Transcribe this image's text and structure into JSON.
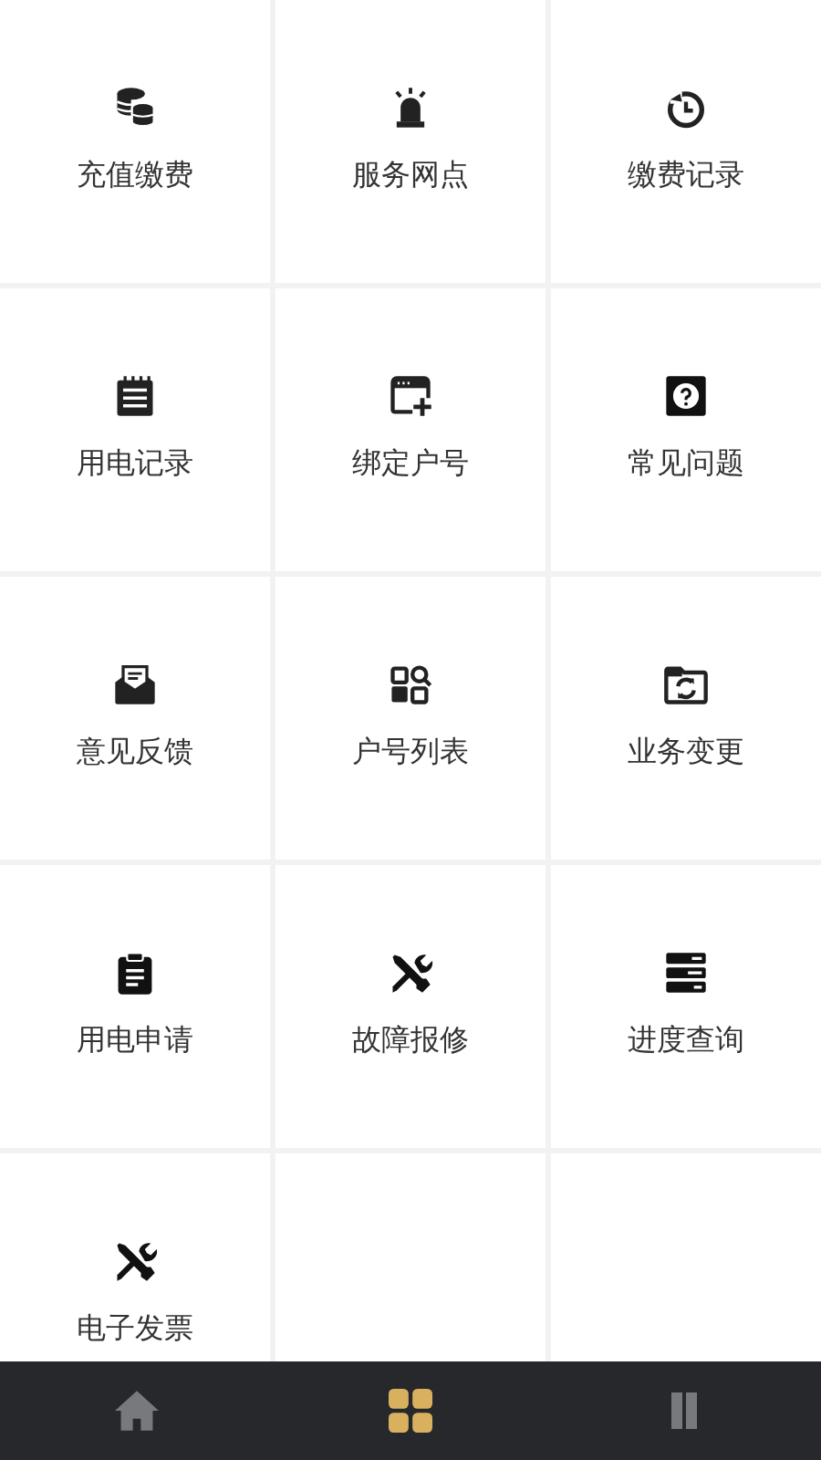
{
  "menu_items": [
    {
      "label": "充值缴费"
    },
    {
      "label": "服务网点"
    },
    {
      "label": "缴费记录"
    },
    {
      "label": "用电记录"
    },
    {
      "label": "绑定户号"
    },
    {
      "label": "常见问题"
    },
    {
      "label": "意见反馈"
    },
    {
      "label": "户号列表"
    },
    {
      "label": "业务变更"
    },
    {
      "label": "用电申请"
    },
    {
      "label": "故障报修"
    },
    {
      "label": "进度查询"
    },
    {
      "label": "电子发票"
    }
  ],
  "tab_bar": [
    {
      "selected": false
    },
    {
      "selected": true
    },
    {
      "selected": false
    }
  ]
}
